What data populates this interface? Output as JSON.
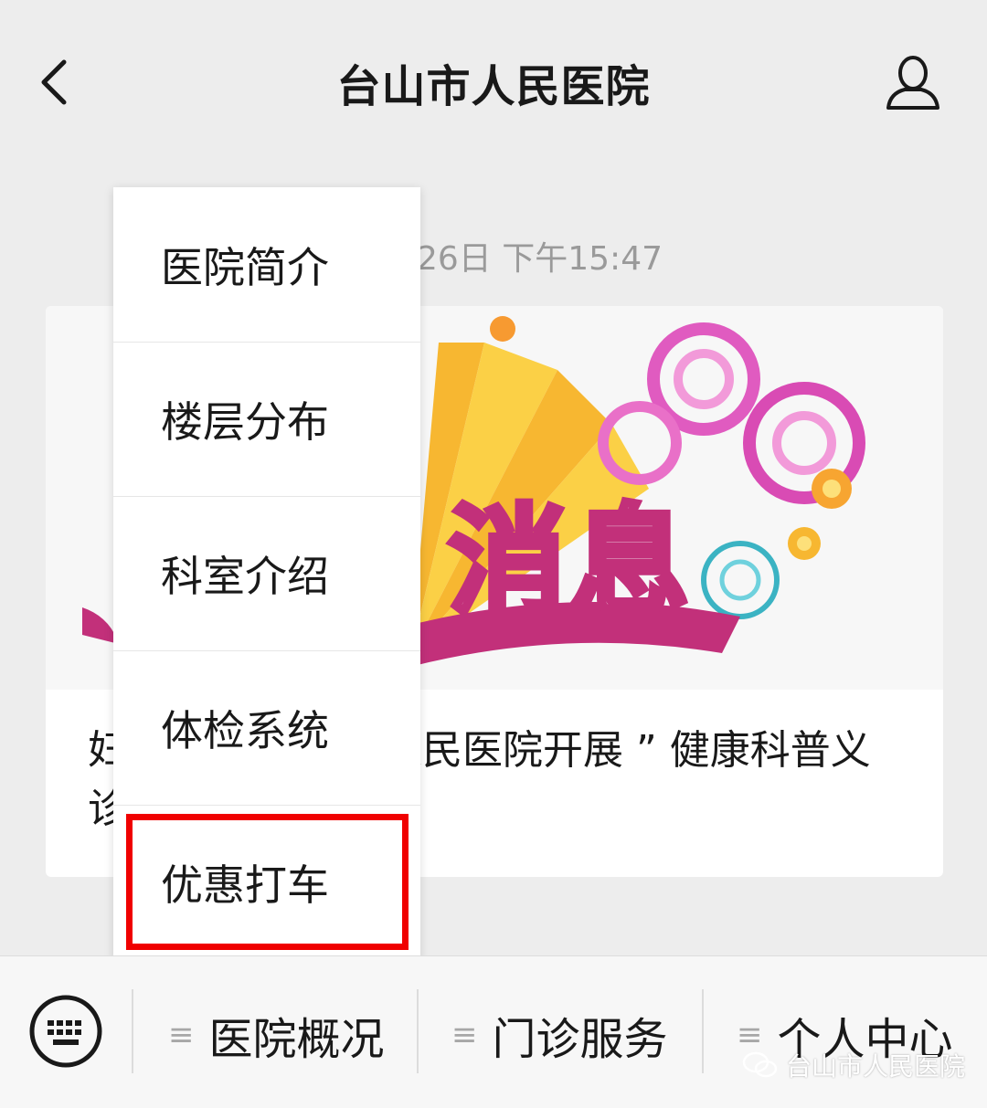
{
  "header": {
    "title": "台山市人民医院",
    "back_icon": "chevron-left-icon",
    "profile_icon": "user-icon"
  },
  "article": {
    "timestamp": "26日 下午15:47",
    "headline": "妇 家联合台山市人民医院开展 ” 健康科普义诊活动",
    "cover_text": "消息"
  },
  "menu": {
    "items": [
      {
        "label": "医院简介"
      },
      {
        "label": "楼层分布"
      },
      {
        "label": "科室介绍"
      },
      {
        "label": "体检系统"
      },
      {
        "label": "优惠打车"
      }
    ],
    "highlight_color": "#f00000"
  },
  "tabbar": {
    "keyboard_icon": "keyboard-icon",
    "menu_icon": "≡",
    "tabs": [
      {
        "label": "医院概况"
      },
      {
        "label": "门诊服务"
      },
      {
        "label": "个人中心"
      }
    ]
  },
  "watermark": {
    "text": "台山市人民医院"
  }
}
